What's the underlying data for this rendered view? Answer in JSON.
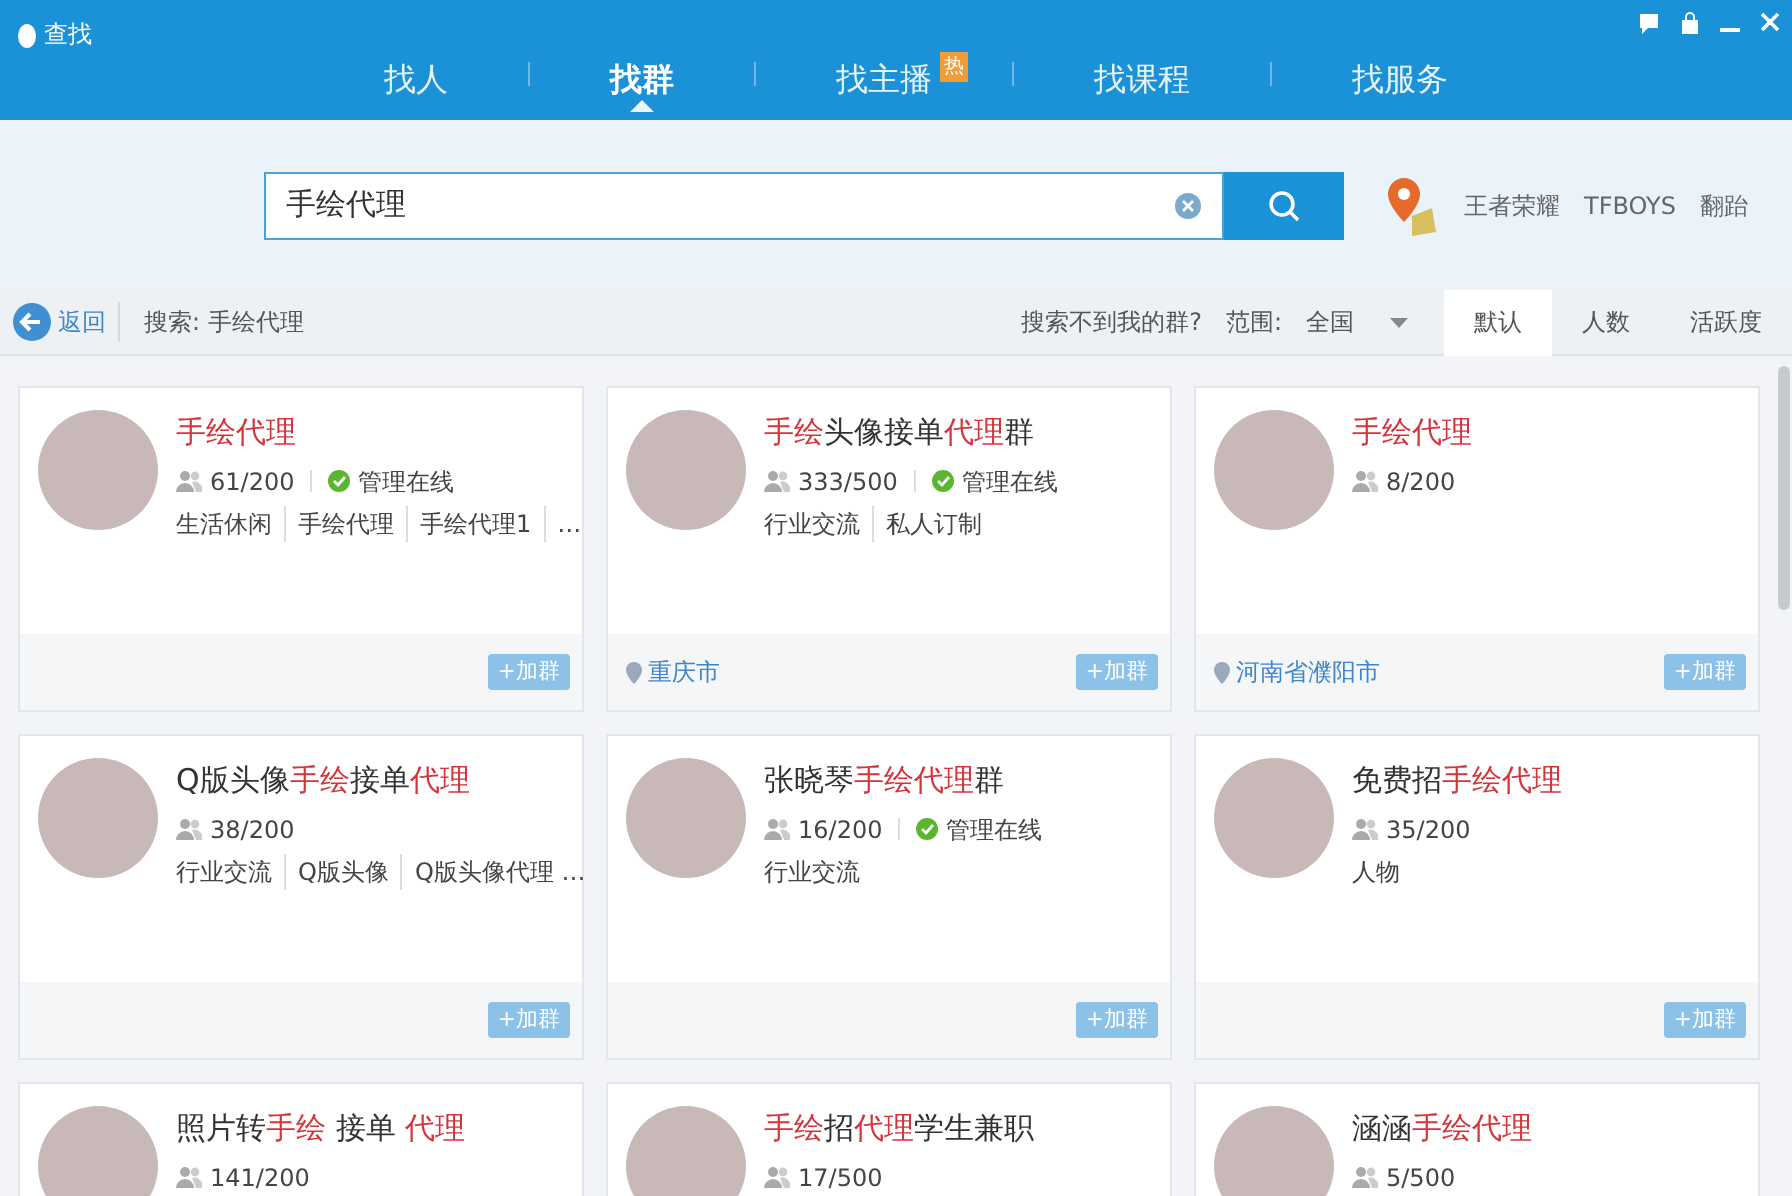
{
  "window": {
    "title": "查找"
  },
  "tabs": [
    {
      "label": "找人",
      "selected": false
    },
    {
      "label": "找群",
      "selected": true
    },
    {
      "label": "找主播",
      "selected": false,
      "badge": "热"
    },
    {
      "label": "找课程",
      "selected": false
    },
    {
      "label": "找服务",
      "selected": false
    }
  ],
  "search": {
    "value": "手绘代理",
    "hot_words": [
      "王者荣耀",
      "TFBOYS",
      "翻跆"
    ]
  },
  "toolbar": {
    "back": "返回",
    "query": "搜索: 手绘代理",
    "not_found": "搜索不到我的群?",
    "range_label": "范围:",
    "range_value": "全国",
    "sort_tabs": [
      {
        "label": "默认",
        "selected": true
      },
      {
        "label": "人数",
        "selected": false
      },
      {
        "label": "活跃度",
        "selected": false
      }
    ]
  },
  "groups": [
    {
      "title": [
        {
          "text": "手绘代理",
          "highlight": true
        }
      ],
      "members": "61/200",
      "admin_online": "管理在线",
      "tags": [
        "生活休闲",
        "手绘代理",
        "手绘代理1",
        "…"
      ],
      "join": "+加群"
    },
    {
      "title": [
        {
          "text": "手绘",
          "highlight": true
        },
        {
          "text": "头像接单",
          "highlight": false
        },
        {
          "text": "代理",
          "highlight": true
        },
        {
          "text": "群",
          "highlight": false
        }
      ],
      "members": "333/500",
      "admin_online": "管理在线",
      "tags": [
        "行业交流",
        "私人订制"
      ],
      "location": "重庆市",
      "join": "+加群"
    },
    {
      "title": [
        {
          "text": "手绘代理",
          "highlight": true
        }
      ],
      "members": "8/200",
      "location": "河南省濮阳市",
      "join": "+加群"
    },
    {
      "title": [
        {
          "text": "Q版头像",
          "highlight": false
        },
        {
          "text": "手绘",
          "highlight": true
        },
        {
          "text": "接单",
          "highlight": false
        },
        {
          "text": "代理",
          "highlight": true
        }
      ],
      "members": "38/200",
      "tags": [
        "行业交流",
        "Q版头像",
        "Q版头像代理 …"
      ],
      "join": "+加群"
    },
    {
      "title": [
        {
          "text": "张晓琴",
          "highlight": false
        },
        {
          "text": "手绘代理",
          "highlight": true
        },
        {
          "text": "群",
          "highlight": false
        }
      ],
      "members": "16/200",
      "admin_online": "管理在线",
      "tags": [
        "行业交流"
      ],
      "join": "+加群"
    },
    {
      "title": [
        {
          "text": "免费招",
          "highlight": false
        },
        {
          "text": "手绘代理",
          "highlight": true
        }
      ],
      "members": "35/200",
      "tags": [
        "人物"
      ],
      "join": "+加群"
    },
    {
      "title": [
        {
          "text": "照片转",
          "highlight": false
        },
        {
          "text": "手绘",
          "highlight": true
        },
        {
          "text": " 接单 ",
          "highlight": false
        },
        {
          "text": "代理",
          "highlight": true
        }
      ],
      "members": "141/200"
    },
    {
      "title": [
        {
          "text": "手绘",
          "highlight": true
        },
        {
          "text": "招",
          "highlight": false
        },
        {
          "text": "代理",
          "highlight": true
        },
        {
          "text": "学生兼职",
          "highlight": false
        }
      ],
      "members": "17/500"
    },
    {
      "title": [
        {
          "text": "涵涵",
          "highlight": false
        },
        {
          "text": "手绘代理",
          "highlight": true
        }
      ],
      "members": "5/500"
    }
  ]
}
